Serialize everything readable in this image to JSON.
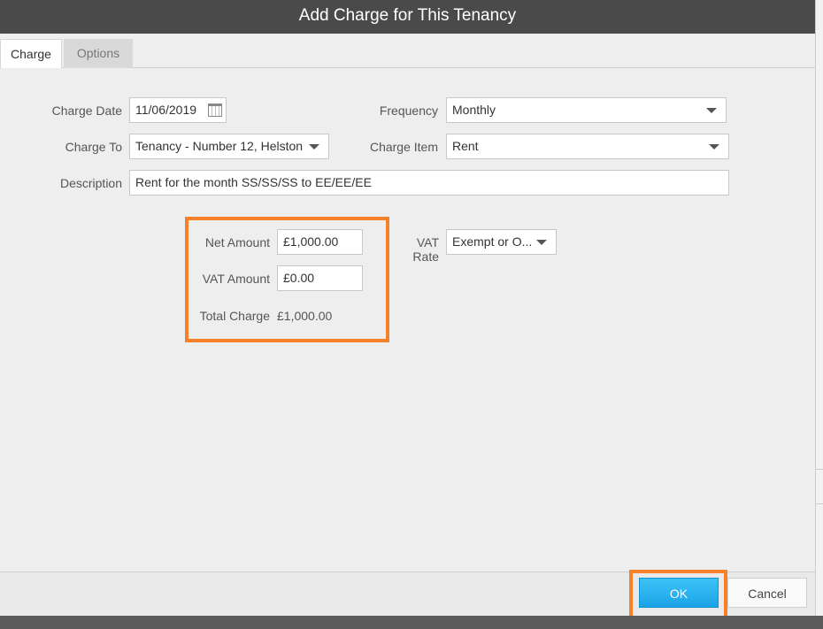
{
  "dialog": {
    "title": "Add Charge for This Tenancy"
  },
  "tabs": [
    {
      "label": "Charge",
      "active": true
    },
    {
      "label": "Options",
      "active": false
    }
  ],
  "form": {
    "charge_date": {
      "label": "Charge Date",
      "value": "11/06/2019"
    },
    "frequency": {
      "label": "Frequency",
      "value": "Monthly"
    },
    "charge_to": {
      "label": "Charge To",
      "value": "Tenancy - Number 12, Helston"
    },
    "charge_item": {
      "label": "Charge Item",
      "value": "Rent"
    },
    "description": {
      "label": "Description",
      "value": "Rent for the month SS/SS/SS to EE/EE/EE"
    },
    "net_amount": {
      "label": "Net Amount",
      "value": "£1,000.00"
    },
    "vat_amount": {
      "label": "VAT Amount",
      "value": "£0.00"
    },
    "total_charge": {
      "label": "Total Charge",
      "value": "£1,000.00"
    },
    "vat_rate": {
      "label": "VAT Rate",
      "value": "Exempt or O..."
    }
  },
  "footer": {
    "ok_label": "OK",
    "cancel_label": "Cancel"
  },
  "colors": {
    "highlight": "#f5822a",
    "ok_button": "#29b3ef",
    "titlebar": "#4a4a4a"
  }
}
